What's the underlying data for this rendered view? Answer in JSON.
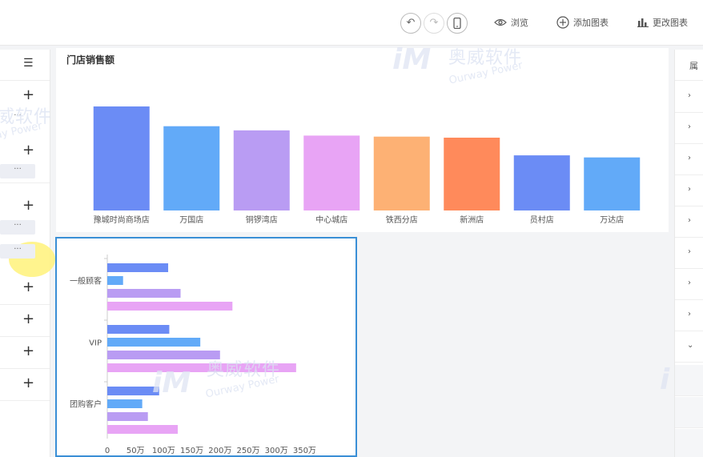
{
  "toolbar": {
    "preview_label": "浏览",
    "add_chart_label": "添加图表",
    "change_chart_label": "更改图表"
  },
  "left_panel": {
    "ellipsis": "···"
  },
  "right_panel": {
    "header": "属"
  },
  "watermark": {
    "cn": "奥威软件",
    "en": "Ourway Power"
  },
  "chart_data": [
    {
      "type": "bar",
      "title": "门店销售额",
      "categories": [
        "豫城时尚商场店",
        "万国店",
        "铜锣湾店",
        "中心城店",
        "铁西分店",
        "新洲店",
        "员村店",
        "万达店"
      ],
      "values": [
        100,
        81,
        77,
        72,
        71,
        70,
        53,
        51
      ],
      "bar_colors": [
        "#6b8cf5",
        "#62aaf8",
        "#b99cf3",
        "#e8a4f5",
        "#fdb174",
        "#ff8a5b",
        "#6b8cf5",
        "#62aaf8"
      ],
      "ylim": [
        0,
        100
      ],
      "grid": false
    },
    {
      "type": "bar",
      "orientation": "horizontal",
      "categories": [
        "一般顾客",
        "VIP",
        "团购客户"
      ],
      "series": [
        {
          "values": [
            108,
            28,
            130,
            222
          ],
          "colors": [
            "#6b8cf5",
            "#62aaf8",
            "#b99cf3",
            "#e8a4f5"
          ]
        },
        {
          "values": [
            110,
            165,
            200,
            335
          ],
          "colors": [
            "#6b8cf5",
            "#62aaf8",
            "#b99cf3",
            "#e8a4f5"
          ]
        },
        {
          "values": [
            92,
            62,
            72,
            125
          ],
          "colors": [
            "#6b8cf5",
            "#62aaf8",
            "#b99cf3",
            "#e8a4f5"
          ]
        }
      ],
      "xticks": [
        "0",
        "50万",
        "100万",
        "150万",
        "200万",
        "250万",
        "300万",
        "350万"
      ],
      "xlim": [
        0,
        350
      ],
      "grid": false
    }
  ]
}
